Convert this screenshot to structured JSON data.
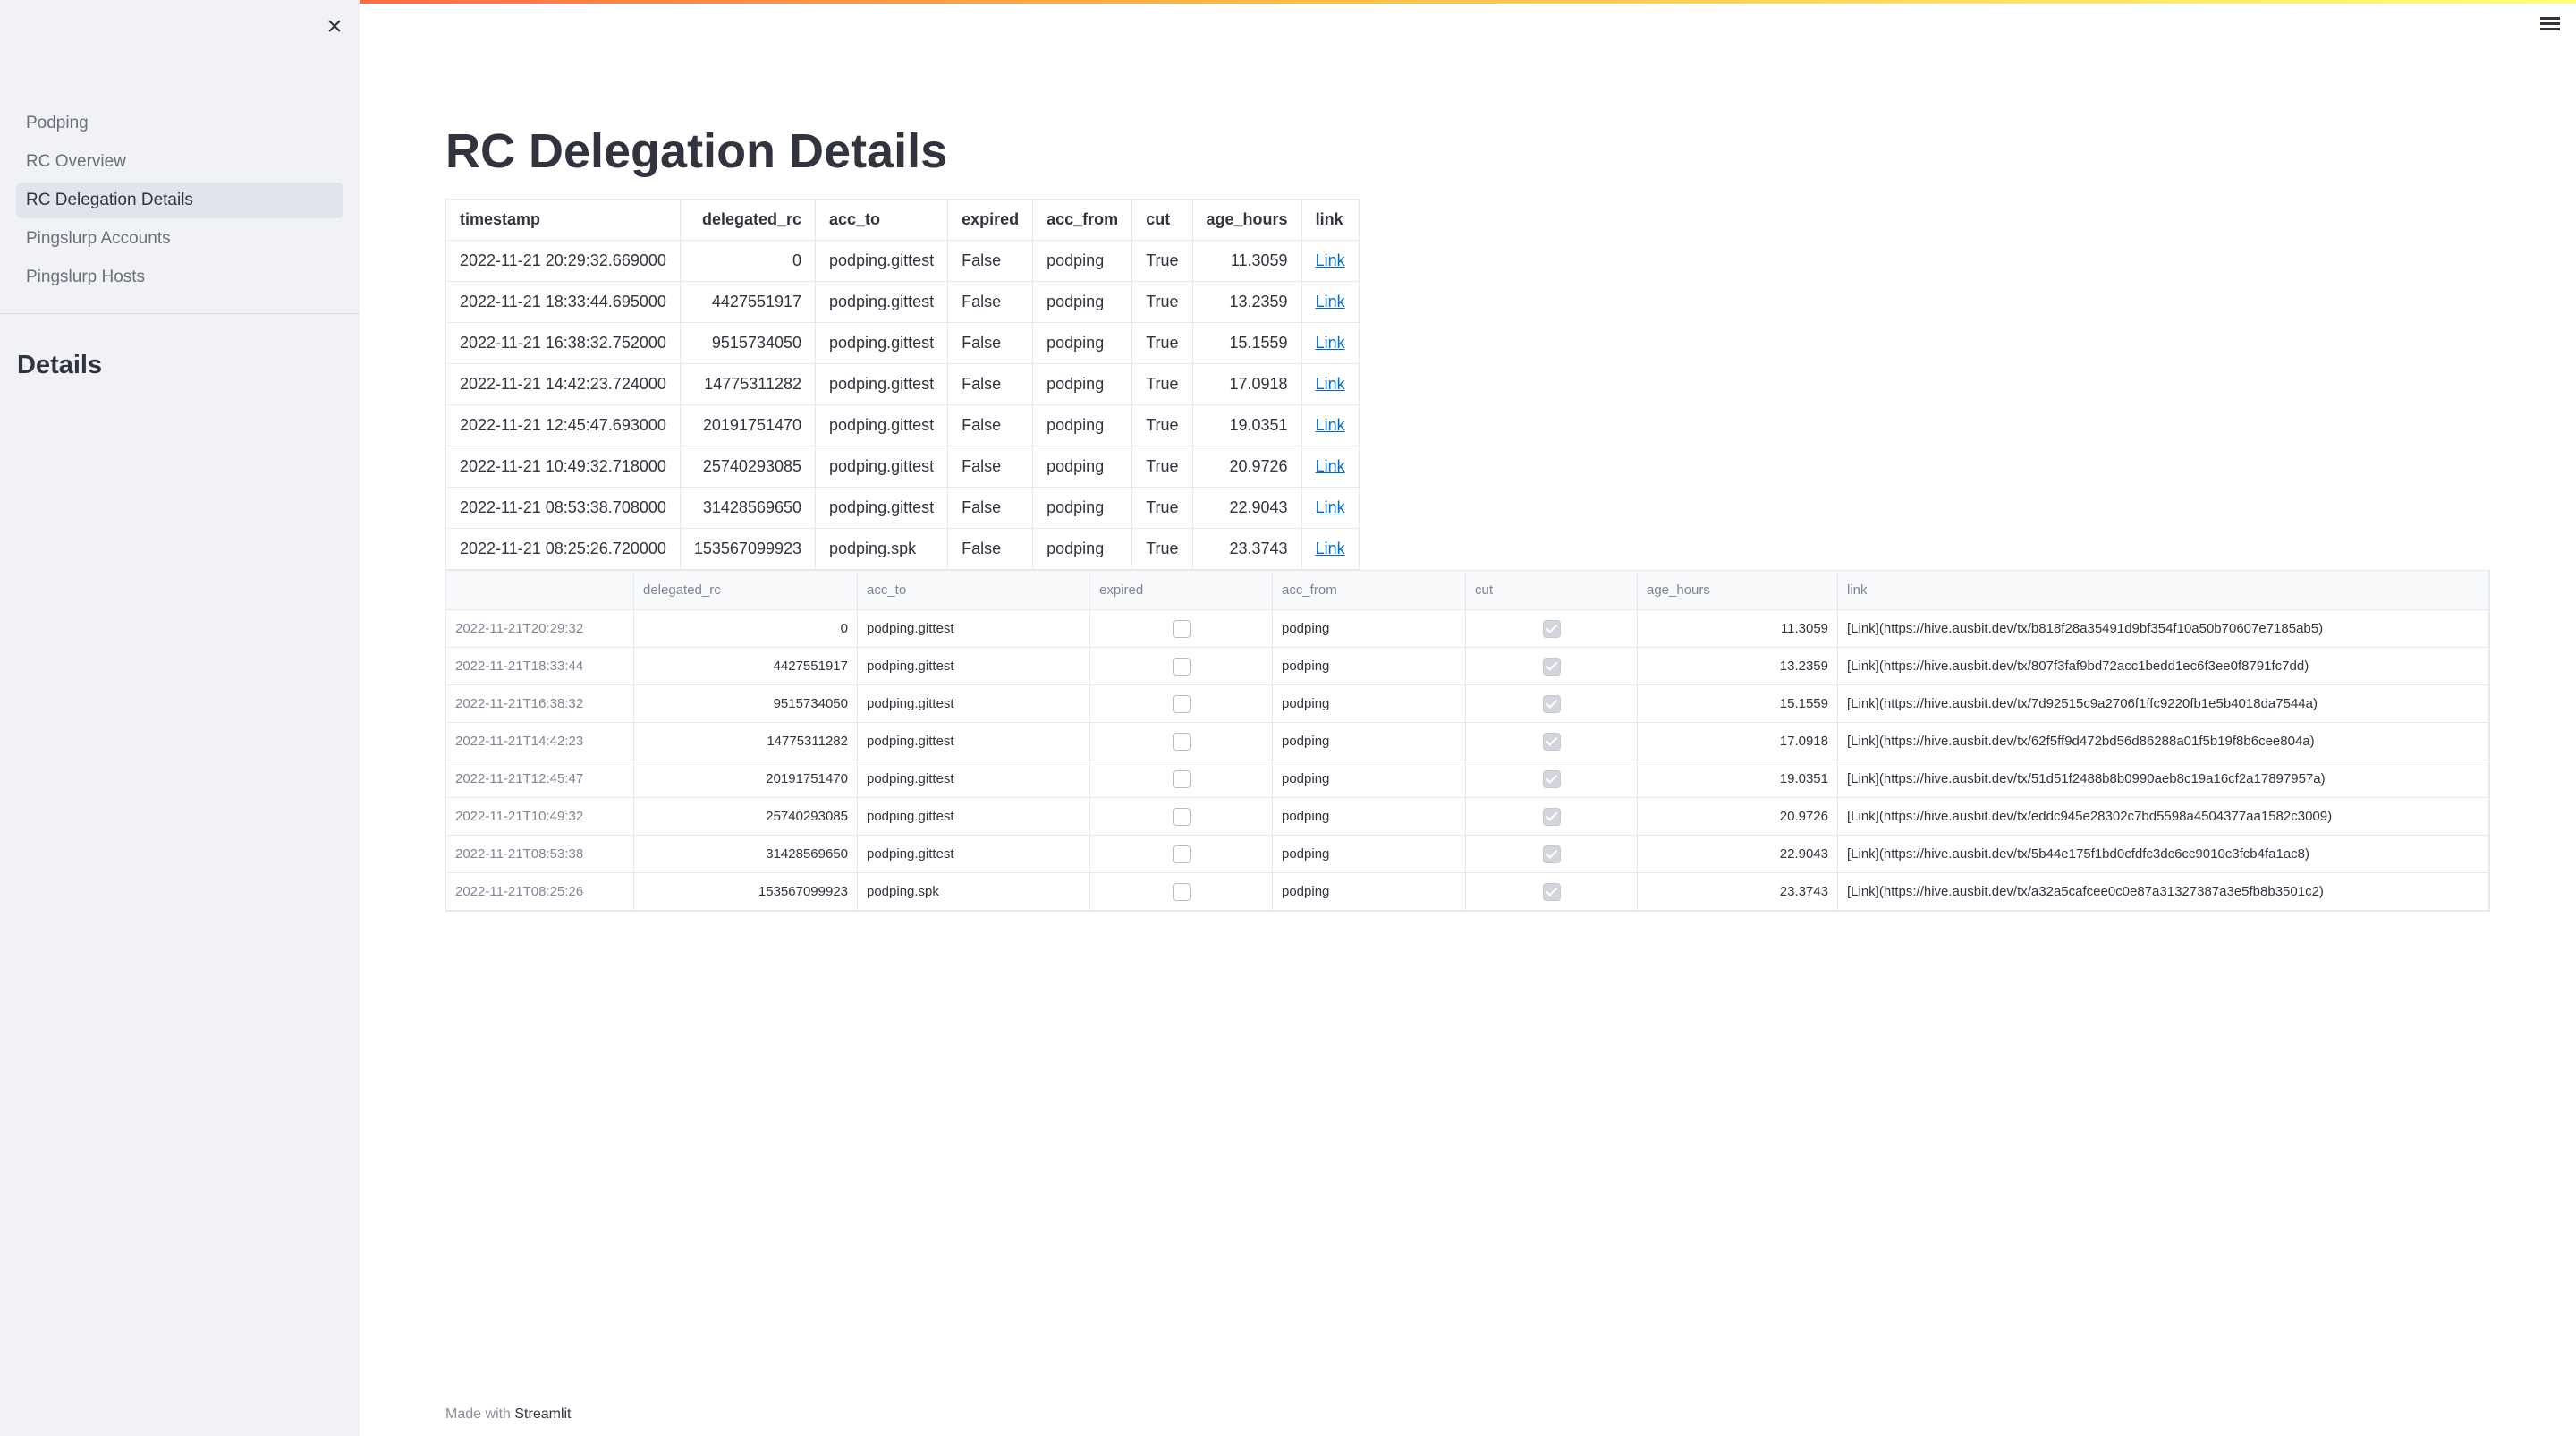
{
  "sidebar": {
    "close_label": "×",
    "nav": [
      {
        "label": "Podping",
        "active": false
      },
      {
        "label": "RC Overview",
        "active": false
      },
      {
        "label": "RC Delegation Details",
        "active": true
      },
      {
        "label": "Pingslurp Accounts",
        "active": false
      },
      {
        "label": "Pingslurp Hosts",
        "active": false
      }
    ],
    "heading": "Details"
  },
  "main": {
    "title": "RC Delegation Details",
    "static_table": {
      "columns": [
        "timestamp",
        "delegated_rc",
        "acc_to",
        "expired",
        "acc_from",
        "cut",
        "age_hours",
        "link"
      ],
      "rows": [
        [
          "2022-11-21 20:29:32.669000",
          "0",
          "podping.gittest",
          "False",
          "podping",
          "True",
          "11.3059",
          "Link"
        ],
        [
          "2022-11-21 18:33:44.695000",
          "4427551917",
          "podping.gittest",
          "False",
          "podping",
          "True",
          "13.2359",
          "Link"
        ],
        [
          "2022-11-21 16:38:32.752000",
          "9515734050",
          "podping.gittest",
          "False",
          "podping",
          "True",
          "15.1559",
          "Link"
        ],
        [
          "2022-11-21 14:42:23.724000",
          "14775311282",
          "podping.gittest",
          "False",
          "podping",
          "True",
          "17.0918",
          "Link"
        ],
        [
          "2022-11-21 12:45:47.693000",
          "20191751470",
          "podping.gittest",
          "False",
          "podping",
          "True",
          "19.0351",
          "Link"
        ],
        [
          "2022-11-21 10:49:32.718000",
          "25740293085",
          "podping.gittest",
          "False",
          "podping",
          "True",
          "20.9726",
          "Link"
        ],
        [
          "2022-11-21 08:53:38.708000",
          "31428569650",
          "podping.gittest",
          "False",
          "podping",
          "True",
          "22.9043",
          "Link"
        ],
        [
          "2022-11-21 08:25:26.720000",
          "153567099923",
          "podping.spk",
          "False",
          "podping",
          "True",
          "23.3743",
          "Link"
        ]
      ]
    },
    "dataframe": {
      "columns": [
        "",
        "delegated_rc",
        "acc_to",
        "expired",
        "acc_from",
        "cut",
        "age_hours",
        "link"
      ],
      "rows": [
        {
          "index": "2022-11-21T20:29:32",
          "delegated_rc": "0",
          "acc_to": "podping.gittest",
          "expired": false,
          "acc_from": "podping",
          "cut": true,
          "age_hours": "11.3059",
          "link": "[Link](https://hive.ausbit.dev/tx/b818f28a35491d9bf354f10a50b70607e7185ab5)"
        },
        {
          "index": "2022-11-21T18:33:44",
          "delegated_rc": "4427551917",
          "acc_to": "podping.gittest",
          "expired": false,
          "acc_from": "podping",
          "cut": true,
          "age_hours": "13.2359",
          "link": "[Link](https://hive.ausbit.dev/tx/807f3faf9bd72acc1bedd1ec6f3ee0f8791fc7dd)"
        },
        {
          "index": "2022-11-21T16:38:32",
          "delegated_rc": "9515734050",
          "acc_to": "podping.gittest",
          "expired": false,
          "acc_from": "podping",
          "cut": true,
          "age_hours": "15.1559",
          "link": "[Link](https://hive.ausbit.dev/tx/7d92515c9a2706f1ffc9220fb1e5b4018da7544a)"
        },
        {
          "index": "2022-11-21T14:42:23",
          "delegated_rc": "14775311282",
          "acc_to": "podping.gittest",
          "expired": false,
          "acc_from": "podping",
          "cut": true,
          "age_hours": "17.0918",
          "link": "[Link](https://hive.ausbit.dev/tx/62f5ff9d472bd56d86288a01f5b19f8b6cee804a)"
        },
        {
          "index": "2022-11-21T12:45:47",
          "delegated_rc": "20191751470",
          "acc_to": "podping.gittest",
          "expired": false,
          "acc_from": "podping",
          "cut": true,
          "age_hours": "19.0351",
          "link": "[Link](https://hive.ausbit.dev/tx/51d51f2488b8b0990aeb8c19a16cf2a17897957a)"
        },
        {
          "index": "2022-11-21T10:49:32",
          "delegated_rc": "25740293085",
          "acc_to": "podping.gittest",
          "expired": false,
          "acc_from": "podping",
          "cut": true,
          "age_hours": "20.9726",
          "link": "[Link](https://hive.ausbit.dev/tx/eddc945e28302c7bd5598a4504377aa1582c3009)"
        },
        {
          "index": "2022-11-21T08:53:38",
          "delegated_rc": "31428569650",
          "acc_to": "podping.gittest",
          "expired": false,
          "acc_from": "podping",
          "cut": true,
          "age_hours": "22.9043",
          "link": "[Link](https://hive.ausbit.dev/tx/5b44e175f1bd0cfdfc3dc6cc9010c3fcb4fa1ac8)"
        },
        {
          "index": "2022-11-21T08:25:26",
          "delegated_rc": "153567099923",
          "acc_to": "podping.spk",
          "expired": false,
          "acc_from": "podping",
          "cut": true,
          "age_hours": "23.3743",
          "link": "[Link](https://hive.ausbit.dev/tx/a32a5cafcee0c0e87a31327387a3e5fb8b3501c2)"
        }
      ]
    }
  },
  "footer": {
    "prefix": "Made with ",
    "brand": "Streamlit"
  },
  "colors": {
    "accent": "#ff4b4b",
    "link": "#0068c9",
    "sidebar_bg": "#f0f2f6"
  },
  "icons": {
    "close": "close-icon",
    "menu": "hamburger-menu-icon"
  }
}
